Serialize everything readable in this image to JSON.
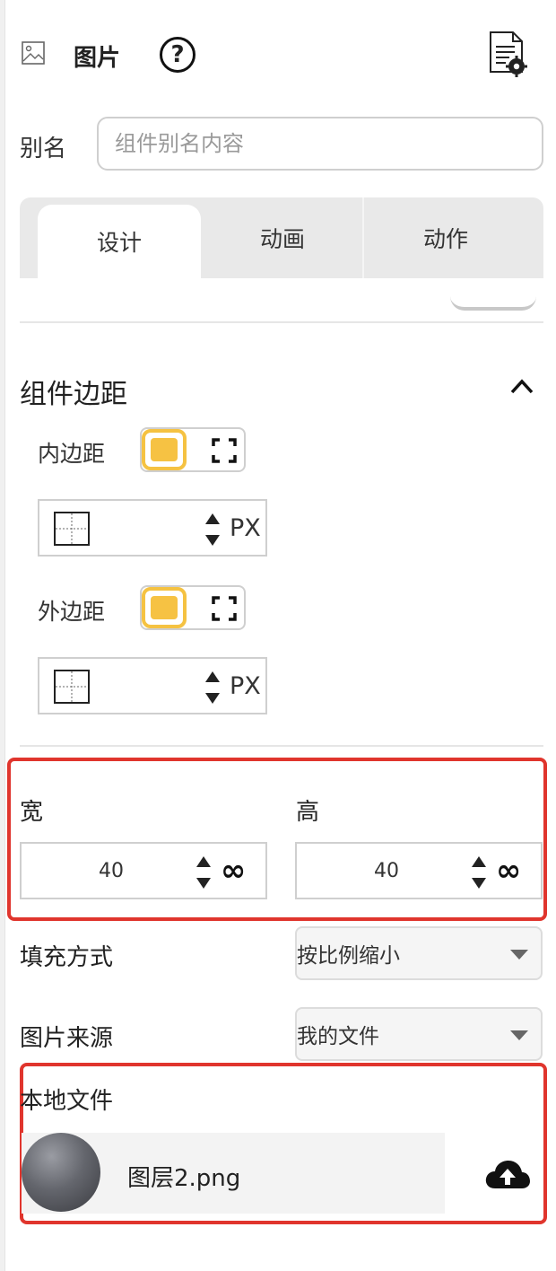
{
  "header": {
    "title": "图片",
    "help_glyph": "?",
    "image_icon": "image-icon",
    "settings_icon": "document-gear-icon"
  },
  "alias": {
    "label": "别名",
    "placeholder": "组件别名内容",
    "value": ""
  },
  "tabs": [
    {
      "label": "设计",
      "active": true
    },
    {
      "label": "动画",
      "active": false
    },
    {
      "label": "动作",
      "active": false
    }
  ],
  "margin_section": {
    "title": "组件边距",
    "padding": {
      "label": "内边距",
      "unit": "PX",
      "value": ""
    },
    "margin": {
      "label": "外边距",
      "unit": "PX",
      "value": ""
    }
  },
  "size": {
    "width": {
      "label": "宽",
      "value": "40",
      "suffix": "∞"
    },
    "height": {
      "label": "高",
      "value": "40",
      "suffix": "∞"
    }
  },
  "fill_mode": {
    "label": "填充方式",
    "value": "按比例缩小"
  },
  "image_source": {
    "label": "图片来源",
    "value": "我的文件"
  },
  "local_file": {
    "label": "本地文件",
    "file_name": "图层2.png"
  },
  "colors": {
    "accent": "#f6c243",
    "highlight": "#e0352d",
    "border": "#cfcfcf"
  }
}
